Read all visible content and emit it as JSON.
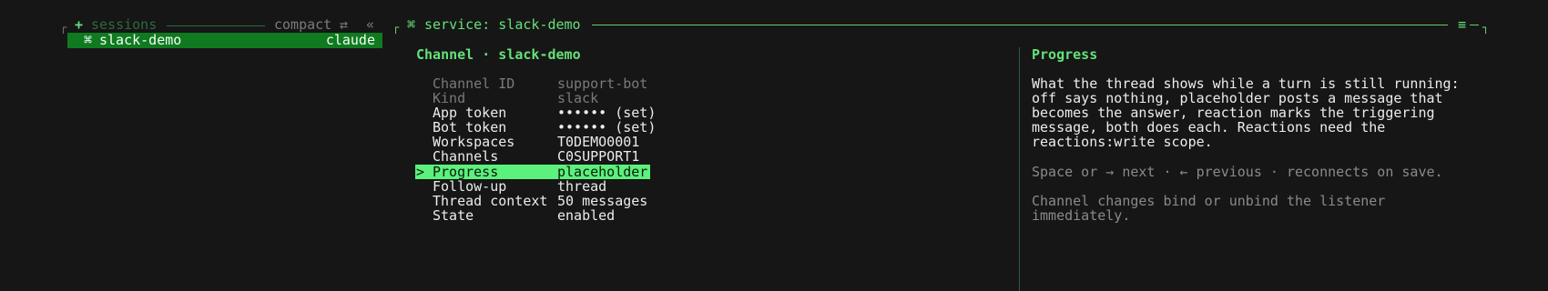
{
  "sessions": {
    "header_icon": "+",
    "header_label": "sessions",
    "mode_label": "compact",
    "swap_icon": "⇄",
    "collapse_icon": "«",
    "items": [
      {
        "icon": "⌘",
        "name": "slack-demo",
        "agent": "claude"
      }
    ]
  },
  "service": {
    "icon": "⌘",
    "title": "service: slack-demo",
    "menu_icon": "≡"
  },
  "channel": {
    "heading": "Channel · slack-demo",
    "fields": [
      {
        "label": "Channel ID",
        "value": "support-bot",
        "style": "dim"
      },
      {
        "label": "Kind",
        "value": "slack",
        "style": "dim"
      },
      {
        "label": "App token",
        "value": "•••••• (set)",
        "style": "normal"
      },
      {
        "label": "Bot token",
        "value": "•••••• (set)",
        "style": "normal"
      },
      {
        "label": "Workspaces",
        "value": "T0DEMO0001",
        "style": "normal"
      },
      {
        "label": "Channels",
        "value": "C0SUPPORT1",
        "style": "normal"
      },
      {
        "label": "Progress",
        "value": "placeholder",
        "style": "selected"
      },
      {
        "label": "Follow-up",
        "value": "thread",
        "style": "normal"
      },
      {
        "label": "Thread context",
        "value": "50 messages",
        "style": "normal"
      },
      {
        "label": "State",
        "value": "enabled",
        "style": "normal"
      }
    ],
    "selected_marker": ">"
  },
  "help": {
    "heading": "Progress",
    "description_lines": [
      "What the thread shows while a turn is still running:",
      "off says nothing, placeholder posts a message that",
      "becomes the answer, reaction marks the triggering",
      "message, both does each. Reactions need the",
      "reactions:write scope."
    ],
    "keys_hint": "Space or → next · ← previous · reconnects on save.",
    "note_lines": [
      "Channel changes bind or unbind the listener",
      "immediately."
    ]
  },
  "colors": {
    "accent": "#65e07a",
    "selected_bg": "#5cf07c",
    "session_bg": "#0f7a1f",
    "background": "#161616"
  }
}
